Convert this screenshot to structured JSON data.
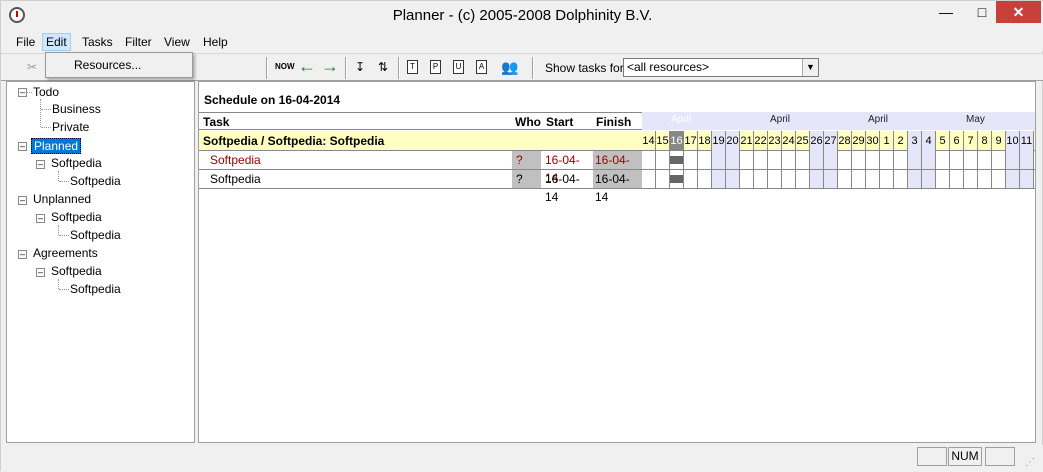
{
  "window": {
    "title": "Planner - (c) 2005-2008 Dolphinity B.V."
  },
  "menu": {
    "file": "File",
    "edit": "Edit",
    "tasks": "Tasks",
    "filter": "Filter",
    "view": "View",
    "help": "Help"
  },
  "edit_menu": {
    "resources": "Resources..."
  },
  "toolbar": {
    "now_label": "NOW",
    "show_tasks_label": "Show tasks for",
    "resource_select": "<all resources>",
    "doc_labels": [
      "T",
      "P",
      "U",
      "A"
    ]
  },
  "tree": [
    {
      "label": "Todo",
      "children": [
        {
          "label": "Business"
        },
        {
          "label": "Private"
        }
      ]
    },
    {
      "label": "Planned",
      "selected": true,
      "children": [
        {
          "label": "Softpedia",
          "children": [
            {
              "label": "Softpedia"
            }
          ]
        }
      ]
    },
    {
      "label": "Unplanned",
      "children": [
        {
          "label": "Softpedia",
          "children": [
            {
              "label": "Softpedia"
            }
          ]
        }
      ]
    },
    {
      "label": "Agreements",
      "children": [
        {
          "label": "Softpedia",
          "children": [
            {
              "label": "Softpedia"
            }
          ]
        }
      ]
    }
  ],
  "schedule": {
    "title": "Schedule on 16-04-2014",
    "columns": {
      "task": "Task",
      "who": "Who",
      "start": "Start",
      "finish": "Finish"
    },
    "months": [
      "April",
      "April",
      "April",
      "May"
    ],
    "group": "Softpedia / Softpedia: Softpedia",
    "days": [
      "14",
      "15",
      "16",
      "17",
      "18",
      "19",
      "20",
      "21",
      "22",
      "23",
      "24",
      "25",
      "26",
      "27",
      "28",
      "29",
      "30",
      "1",
      "2",
      "3",
      "4",
      "5",
      "6",
      "7",
      "8",
      "9",
      "10",
      "11"
    ],
    "today_day": "16",
    "weekend_days": [
      "19",
      "20",
      "26",
      "27",
      "3",
      "4",
      "10",
      "11"
    ],
    "rows": [
      {
        "task": "Softpedia",
        "who": "?",
        "start": "16-04-14",
        "finish": "16-04-14",
        "overdue": true
      },
      {
        "task": "Softpedia",
        "who": "?",
        "start": "16-04-14",
        "finish": "16-04-14",
        "overdue": false
      }
    ]
  },
  "statusbar": {
    "num": "NUM"
  },
  "colors": {
    "selection": "#0078d7",
    "group_bg": "#ffffc0",
    "weekend": "#e6e6fa",
    "overdue_text": "#a00000",
    "close": "#c7403a"
  }
}
